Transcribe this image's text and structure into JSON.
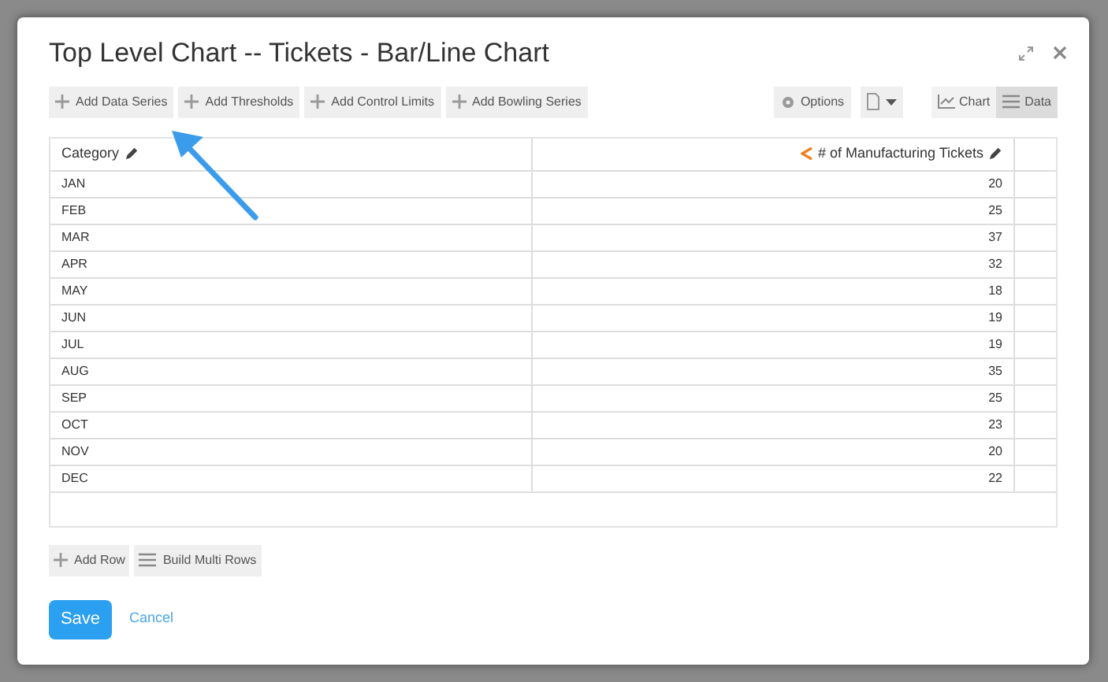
{
  "dialog": {
    "title": "Top Level Chart -- Tickets - Bar/Line Chart"
  },
  "toolbar": {
    "add_buttons": [
      "Add Data Series",
      "Add Thresholds",
      "Add Control Limits",
      "Add Bowling Series"
    ],
    "options": "Options",
    "view_tabs": [
      {
        "label": "Chart",
        "kind": "chart",
        "selected": false
      },
      {
        "label": "Data",
        "kind": "data",
        "selected": true
      }
    ]
  },
  "table": {
    "columns": [
      "Category",
      "# of Manufacturing Tickets"
    ],
    "rows": [
      [
        "JAN",
        "20"
      ],
      [
        "FEB",
        "25"
      ],
      [
        "MAR",
        "37"
      ],
      [
        "APR",
        "32"
      ],
      [
        "MAY",
        "18"
      ],
      [
        "JUN",
        "19"
      ],
      [
        "JUL",
        "19"
      ],
      [
        "AUG",
        "35"
      ],
      [
        "SEP",
        "25"
      ],
      [
        "OCT",
        "23"
      ],
      [
        "NOV",
        "20"
      ],
      [
        "DEC",
        "22"
      ]
    ]
  },
  "row_actions": [
    {
      "label": "Add Row",
      "kind": "add"
    },
    {
      "label": "Build Multi Rows",
      "kind": "multi"
    }
  ],
  "footer": {
    "save": "Save",
    "cancel": "Cancel"
  }
}
